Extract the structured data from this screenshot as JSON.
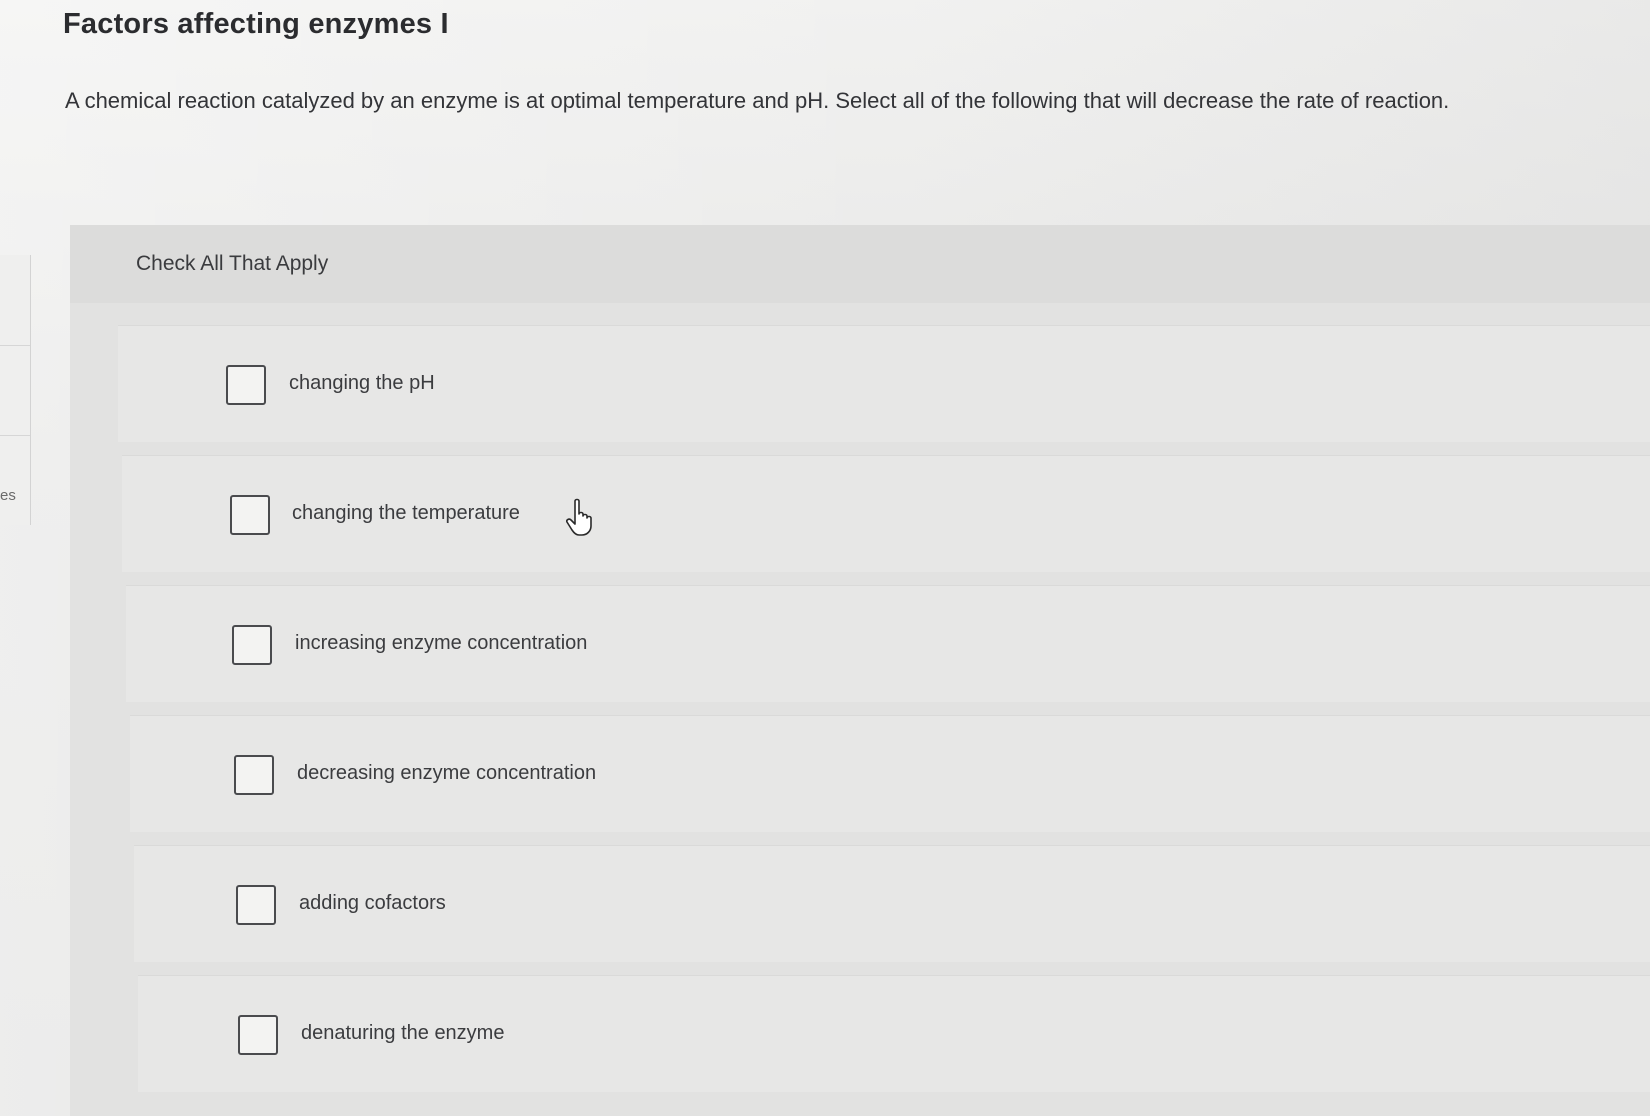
{
  "question": {
    "title": "Factors affecting enzymes I",
    "prompt": "A chemical reaction catalyzed by an enzyme is at optimal temperature and pH. Select all of the following that will decrease the rate of reaction."
  },
  "side_tab": {
    "fragment": "es"
  },
  "panel": {
    "header": "Check All That Apply",
    "options": [
      {
        "label": "changing the pH",
        "checked": false
      },
      {
        "label": "changing the temperature",
        "checked": false
      },
      {
        "label": "increasing enzyme concentration",
        "checked": false
      },
      {
        "label": "decreasing enzyme concentration",
        "checked": false
      },
      {
        "label": "adding cofactors",
        "checked": false
      },
      {
        "label": "denaturing the enzyme",
        "checked": false
      }
    ]
  },
  "icons": {
    "cursor": "hand-pointer-icon"
  }
}
